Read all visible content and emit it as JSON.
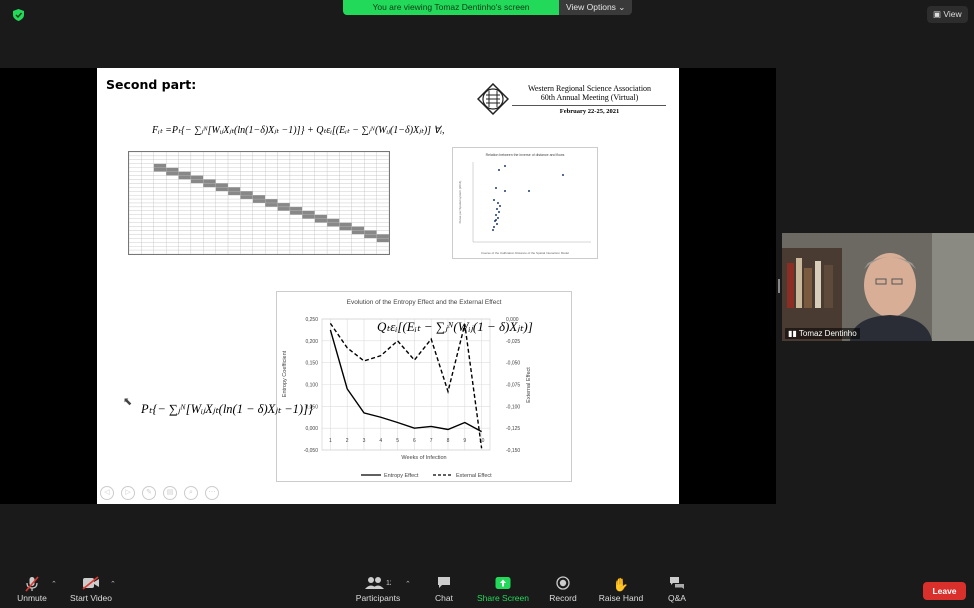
{
  "banner": {
    "sharing_text": "You are viewing Tomaz Dentinho's screen",
    "view_options": "View Options ⌄"
  },
  "top_right": {
    "view_label": "View"
  },
  "slide": {
    "title": "Second part:",
    "conference": {
      "line1": "Western Regional Science Association",
      "line2": "60th Annual Meeting (Virtual)",
      "date": "February 22-25, 2021"
    },
    "formula_top": "Fᵢₜ =Pₜ{− ∑ⱼᴺ[WᵢⱼXⱼₜ(ln(1−δ)Xⱼₜ −1)]} + Qₜεᵢ[(Eᵢₜ − ∑ⱼᴺ(Wᵢⱼ(1−δ)Xⱼₜ)] ∀ᵢ,",
    "formula_external": "Qₜεᵢ[(Eᵢₜ − ∑ⱼᴺ(Wᵢⱼ(1 − δ)Xⱼₜ)]",
    "formula_entropy": "Pₜ{− ∑ⱼᴺ[WᵢⱼXⱼₜ(ln(1 − δ)Xⱼₜ −1)]}",
    "scatter_title": "Relation between the inverse of distance and flows",
    "scatter_xlabel": "Inverse of the Calibration Distance of the Spatial Interaction Model",
    "scatter_ylabel": "Flows per Spatial system (2014)"
  },
  "chart_data": {
    "type": "line",
    "title": "Evolution of the Entropy Effect and the External Effect",
    "xlabel": "Weeks of Infection",
    "ylabel": "Entropy Coefficient",
    "y2label": "External Effect",
    "x": [
      1,
      2,
      3,
      4,
      5,
      6,
      7,
      8,
      9,
      10
    ],
    "xlim": [
      0.5,
      10.5
    ],
    "ylim": [
      -0.05,
      0.25
    ],
    "y2lim": [
      -0.15,
      0.0
    ],
    "yticks": [
      "0,250",
      "0,200",
      "0,150",
      "0,100",
      "0,050",
      "0,000",
      "-0,050"
    ],
    "y2ticks": [
      "0,000",
      "-0,025",
      "-0,050",
      "-0,075",
      "-0,100",
      "-0,125",
      "-0,150"
    ],
    "xticks": [
      "1",
      "2",
      "3",
      "4",
      "5",
      "6",
      "7",
      "8",
      "9",
      "10"
    ],
    "series": [
      {
        "name": "Entropy Effect",
        "axis": "left",
        "style": "solid",
        "values": [
          0.225,
          0.09,
          0.035,
          0.025,
          0.013,
          0.0,
          0.004,
          -0.003,
          0.013,
          -0.008
        ]
      },
      {
        "name": "External Effect",
        "axis": "right",
        "style": "dashed",
        "values": [
          -0.005,
          -0.033,
          -0.048,
          -0.042,
          -0.025,
          -0.047,
          -0.023,
          -0.083,
          -0.006,
          -0.148
        ]
      }
    ],
    "legend": "bottom",
    "grid": true
  },
  "video": {
    "participant_name": "Tomaz Dentinho"
  },
  "toolbar": {
    "unmute": "Unmute",
    "start_video": "Start Video",
    "participants": "Participants",
    "participants_count": "12",
    "chat": "Chat",
    "share_screen": "Share Screen",
    "record": "Record",
    "raise_hand": "Raise Hand",
    "qa": "Q&A",
    "leave": "Leave"
  },
  "colors": {
    "banner_green": "#23d959",
    "share_green": "#23d959",
    "leave_red": "#d9302c"
  }
}
